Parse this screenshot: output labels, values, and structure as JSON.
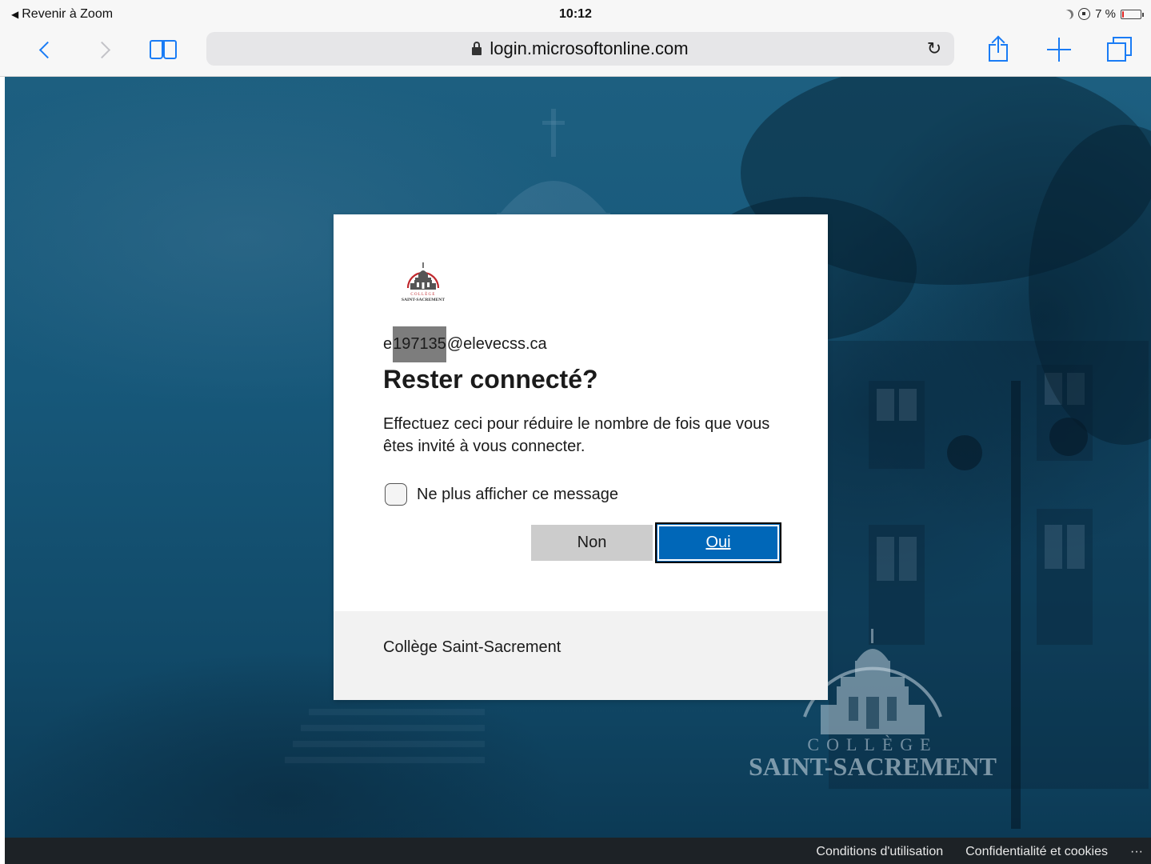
{
  "status_bar": {
    "back_label": "Revenir à Zoom",
    "time": "10:12",
    "battery_text": "7 %",
    "battery_level": 0.07
  },
  "browser": {
    "url": "login.microsoftonline.com"
  },
  "dialog": {
    "account": {
      "prefix": "e",
      "redacted": "197135",
      "suffix": "@elevecss.ca"
    },
    "title": "Rester connecté?",
    "description": "Effectuez ceci pour réduire le nombre de fois que vous êtes invité à vous connecter.",
    "checkbox_label": "Ne plus afficher ce message",
    "checkbox_checked": false,
    "btn_no": "Non",
    "btn_yes": "Oui",
    "org_name": "Collège Saint-Sacrement",
    "logo": {
      "line1": "COLLÈGE",
      "line2": "SAINT-SACREMENT"
    }
  },
  "background_watermark": {
    "line1": "COLLÈGE",
    "line2": "SAINT-SACREMENT"
  },
  "footer": {
    "terms": "Conditions d'utilisation",
    "privacy": "Confidentialité et cookies",
    "more": "···"
  },
  "colors": {
    "primary_button": "#0067b8",
    "secondary_button": "#cccccc",
    "ios_blue": "#1a7cf5",
    "background": "#17587a"
  }
}
